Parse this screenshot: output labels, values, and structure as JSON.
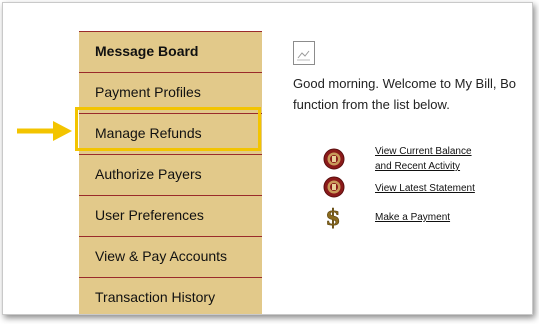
{
  "sidebar": {
    "items": [
      {
        "label": "Message Board"
      },
      {
        "label": "Payment Profiles"
      },
      {
        "label": "Manage Refunds"
      },
      {
        "label": "Authorize Payers"
      },
      {
        "label": "User Preferences"
      },
      {
        "label": "View & Pay Accounts"
      },
      {
        "label": "Transaction History"
      }
    ]
  },
  "main": {
    "greeting_line1": "Good morning. Welcome to My Bill, Bo",
    "greeting_line2": "function from the list below.",
    "links": [
      {
        "line1": "View Current Balance",
        "line2": "and Recent Activity",
        "icon": "seal-icon"
      },
      {
        "line1": "View Latest Statement",
        "icon": "seal-icon"
      },
      {
        "line1": "Make a Payment",
        "icon": "dollar-icon"
      }
    ]
  },
  "colors": {
    "sidebar_bg": "#e2c98a",
    "divider": "#9a2b2b",
    "highlight": "#f3c400",
    "seal": "#8b1a1a"
  }
}
